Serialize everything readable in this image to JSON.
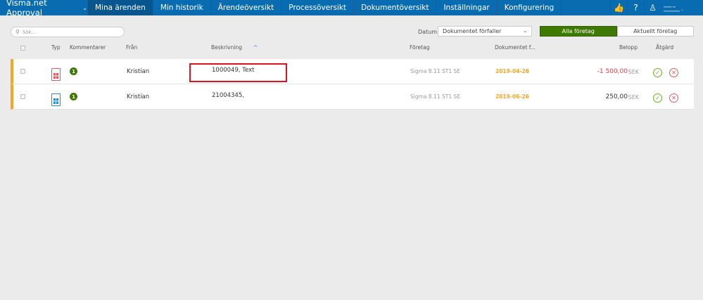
{
  "nav": {
    "brand": "Visma.net Approval",
    "tabs": [
      "Mina ärenden",
      "Min historik",
      "Ärendeöversikt",
      "Processöversikt",
      "Dokumentöversikt",
      "Inställningar",
      "Konfigurering"
    ],
    "active": 0
  },
  "search": {
    "placeholder": "Sök..."
  },
  "filter": {
    "datum_label": "Datum",
    "datum_value": "Dokumentet förfaller",
    "seg": [
      "Alla företag",
      "Aktuellt företag"
    ]
  },
  "columns": {
    "typ": "Typ",
    "kommentarer": "Kommentarer",
    "fran": "Från",
    "beskrivning": "Beskrivning",
    "foretag": "Företag",
    "dokument": "Dokumentet f...",
    "belopp": "Belopp",
    "atgard": "Åtgärd"
  },
  "rows": [
    {
      "comments": "1",
      "from": "Kristian",
      "desc": "1000049, Text",
      "company": "Sigma 8.11 ST1 SE",
      "date": "2019-04-26",
      "amount": "-1 500,00",
      "currency": "SEK",
      "type_color": "#e05a5a",
      "amount_color": "#e8394a"
    },
    {
      "comments": "1",
      "from": "Kristian",
      "desc": "21004345,",
      "company": "Sigma 8.11 ST1 SE",
      "date": "2019-06-26",
      "amount": "250,00",
      "currency": "SEK",
      "type_color": "#2a8ad4",
      "amount_color": "#333333"
    }
  ]
}
